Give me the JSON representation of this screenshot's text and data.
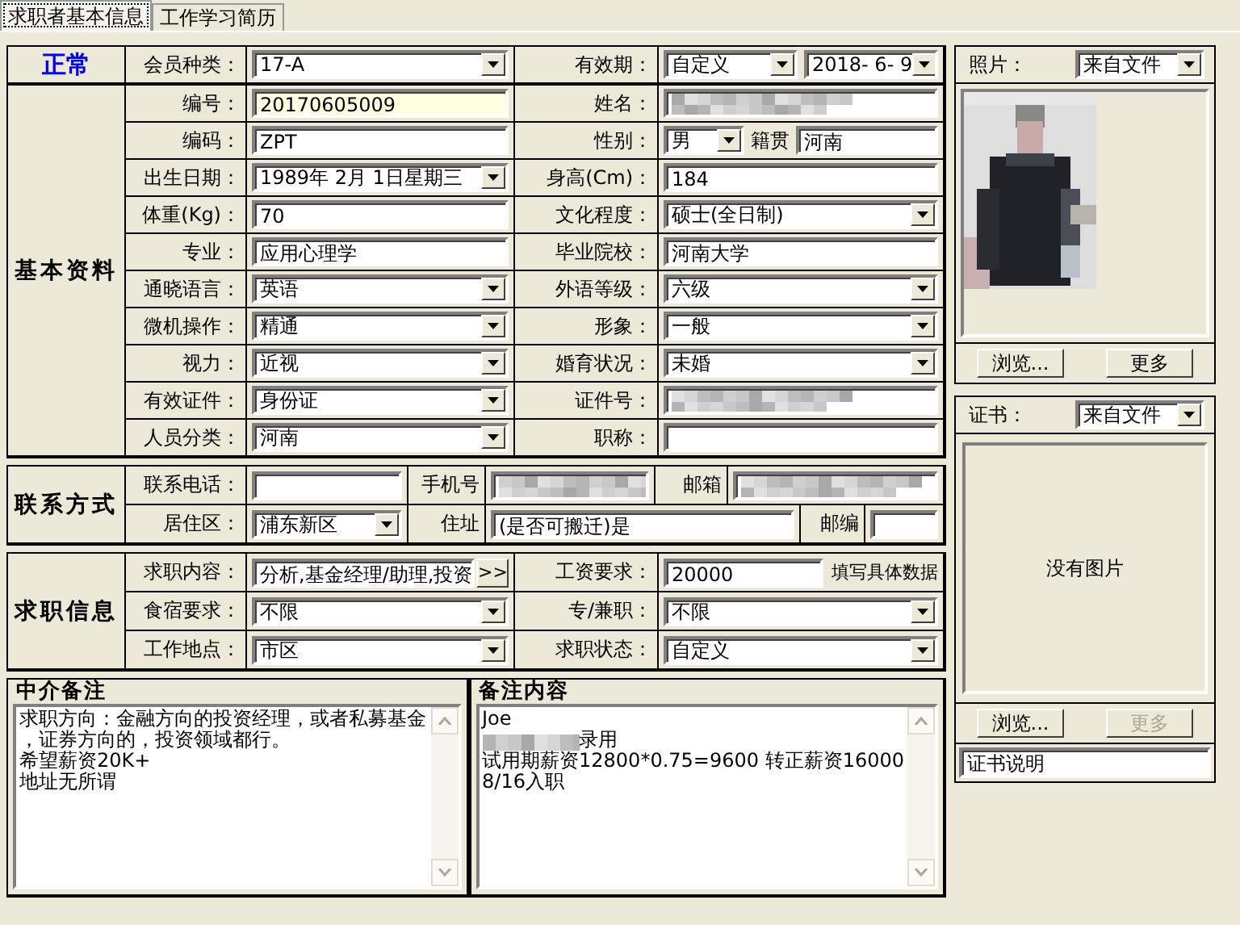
{
  "tabs": [
    {
      "label": "求职者基本信息",
      "selected": true
    },
    {
      "label": "工作学习简历",
      "selected": false
    }
  ],
  "header": {
    "status": "正常",
    "cells": [
      {
        "kind": "label",
        "text": "会员种类："
      },
      {
        "kind": "select",
        "value": "17-A"
      },
      {
        "kind": "label",
        "text": "有效期："
      },
      {
        "kind": "group",
        "parts": [
          {
            "kind": "select",
            "value": "自定义"
          },
          {
            "kind": "select",
            "value": "2018- 6- 9"
          }
        ]
      }
    ]
  },
  "sections": [
    {
      "title": "基本资料",
      "kind": "grid",
      "rows": [
        [
          {
            "kind": "label",
            "text": "编号："
          },
          {
            "kind": "highlighted",
            "value": "20170605009"
          },
          {
            "kind": "label",
            "text": "姓名："
          },
          {
            "kind": "blurred"
          }
        ],
        [
          {
            "kind": "label",
            "text": "编码："
          },
          {
            "kind": "text",
            "value": "ZPT"
          },
          {
            "kind": "label",
            "text": "性别："
          },
          {
            "kind": "group",
            "parts": [
              {
                "kind": "select",
                "value": "男"
              },
              {
                "kind": "label",
                "text": "籍贯"
              },
              {
                "kind": "text",
                "value": "河南"
              }
            ]
          }
        ],
        [
          {
            "kind": "label",
            "text": "出生日期："
          },
          {
            "kind": "select",
            "value": "1989年 2月 1日星期三"
          },
          {
            "kind": "label",
            "text": "身高(Cm)："
          },
          {
            "kind": "text",
            "value": "184"
          }
        ],
        [
          {
            "kind": "label",
            "text": "体重(Kg)："
          },
          {
            "kind": "text",
            "value": "70"
          },
          {
            "kind": "label",
            "text": "文化程度："
          },
          {
            "kind": "select",
            "value": "硕士(全日制)"
          }
        ],
        [
          {
            "kind": "label",
            "text": "专业："
          },
          {
            "kind": "text",
            "value": "应用心理学"
          },
          {
            "kind": "label",
            "text": "毕业院校："
          },
          {
            "kind": "text",
            "value": "河南大学"
          }
        ],
        [
          {
            "kind": "label",
            "text": "通晓语言："
          },
          {
            "kind": "select",
            "value": "英语"
          },
          {
            "kind": "label",
            "text": "外语等级："
          },
          {
            "kind": "select",
            "value": "六级"
          }
        ],
        [
          {
            "kind": "label",
            "text": "微机操作："
          },
          {
            "kind": "select",
            "value": "精通"
          },
          {
            "kind": "label",
            "text": "形象："
          },
          {
            "kind": "select",
            "value": "一般"
          }
        ],
        [
          {
            "kind": "label",
            "text": "视力："
          },
          {
            "kind": "select",
            "value": "近视"
          },
          {
            "kind": "label",
            "text": "婚育状况："
          },
          {
            "kind": "select",
            "value": "未婚"
          }
        ],
        [
          {
            "kind": "label",
            "text": "有效证件："
          },
          {
            "kind": "select",
            "value": "身份证"
          },
          {
            "kind": "label",
            "text": "证件号："
          },
          {
            "kind": "blurred"
          }
        ],
        [
          {
            "kind": "label",
            "text": "人员分类："
          },
          {
            "kind": "select",
            "value": "河南"
          },
          {
            "kind": "label",
            "text": "职称："
          },
          {
            "kind": "text"
          }
        ]
      ]
    },
    {
      "title": "联系方式",
      "kind": "contact",
      "rows": [
        [
          {
            "kind": "label",
            "text": "联系电话："
          },
          {
            "kind": "text"
          },
          {
            "kind": "label",
            "text": "手机号"
          },
          {
            "kind": "blurred"
          },
          {
            "kind": "label",
            "text": "邮箱"
          },
          {
            "kind": "blurred"
          }
        ],
        [
          {
            "kind": "label",
            "text": "居住区："
          },
          {
            "kind": "select",
            "value": "浦东新区"
          },
          {
            "kind": "label",
            "text": "住址"
          },
          {
            "kind": "text",
            "value": "(是否可搬迁)是"
          },
          {
            "kind": "label",
            "text": "邮编"
          },
          {
            "kind": "text"
          }
        ]
      ]
    },
    {
      "title": "求职信息",
      "kind": "grid",
      "rows": [
        [
          {
            "kind": "label",
            "text": "求职内容："
          },
          {
            "kind": "text",
            "value": "分析,基金经理/助理,投资",
            "button": ">>"
          },
          {
            "kind": "label",
            "text": "工资要求："
          },
          {
            "kind": "group",
            "parts": [
              {
                "kind": "text",
                "value": "20000"
              },
              {
                "kind": "note",
                "text": "填写具体数据"
              }
            ]
          }
        ],
        [
          {
            "kind": "label",
            "text": "食宿要求："
          },
          {
            "kind": "select",
            "value": "不限"
          },
          {
            "kind": "label",
            "text": "专/兼职："
          },
          {
            "kind": "select",
            "value": "不限"
          }
        ],
        [
          {
            "kind": "label",
            "text": "工作地点："
          },
          {
            "kind": "select",
            "value": "市区"
          },
          {
            "kind": "label",
            "text": "求职状态："
          },
          {
            "kind": "select",
            "value": "自定义"
          }
        ]
      ]
    }
  ],
  "notes": [
    {
      "title": "中介备注",
      "lines": [
        {
          "text": "求职方向：金融方向的投资经理，或者私募基金",
          "redacted": false
        },
        {
          "text": "，证券方向的，投资领域都行。",
          "redacted": false
        },
        {
          "text": "希望薪资20K+",
          "redacted": false
        },
        {
          "text": "地址无所谓",
          "redacted": false
        }
      ]
    },
    {
      "title": "备注内容",
      "lines": [
        {
          "text": "Joe",
          "redacted": false
        },
        {
          "text": "录用",
          "redacted": true
        },
        {
          "text": "试用期薪资12800*0.75=9600 转正薪资16000",
          "redacted": false
        },
        {
          "text": "8/16入职",
          "redacted": false
        }
      ]
    }
  ],
  "photo": {
    "label": "照片：",
    "source": "来自文件",
    "buttons": [
      {
        "label": "浏览...",
        "disabled": false
      },
      {
        "label": "更多",
        "disabled": false
      }
    ]
  },
  "certificate": {
    "label": "证书：",
    "source": "来自文件",
    "empty_text": "没有图片",
    "buttons": [
      {
        "label": "浏览...",
        "disabled": false
      },
      {
        "label": "更多",
        "disabled": true
      }
    ],
    "caption": "证书说明"
  }
}
